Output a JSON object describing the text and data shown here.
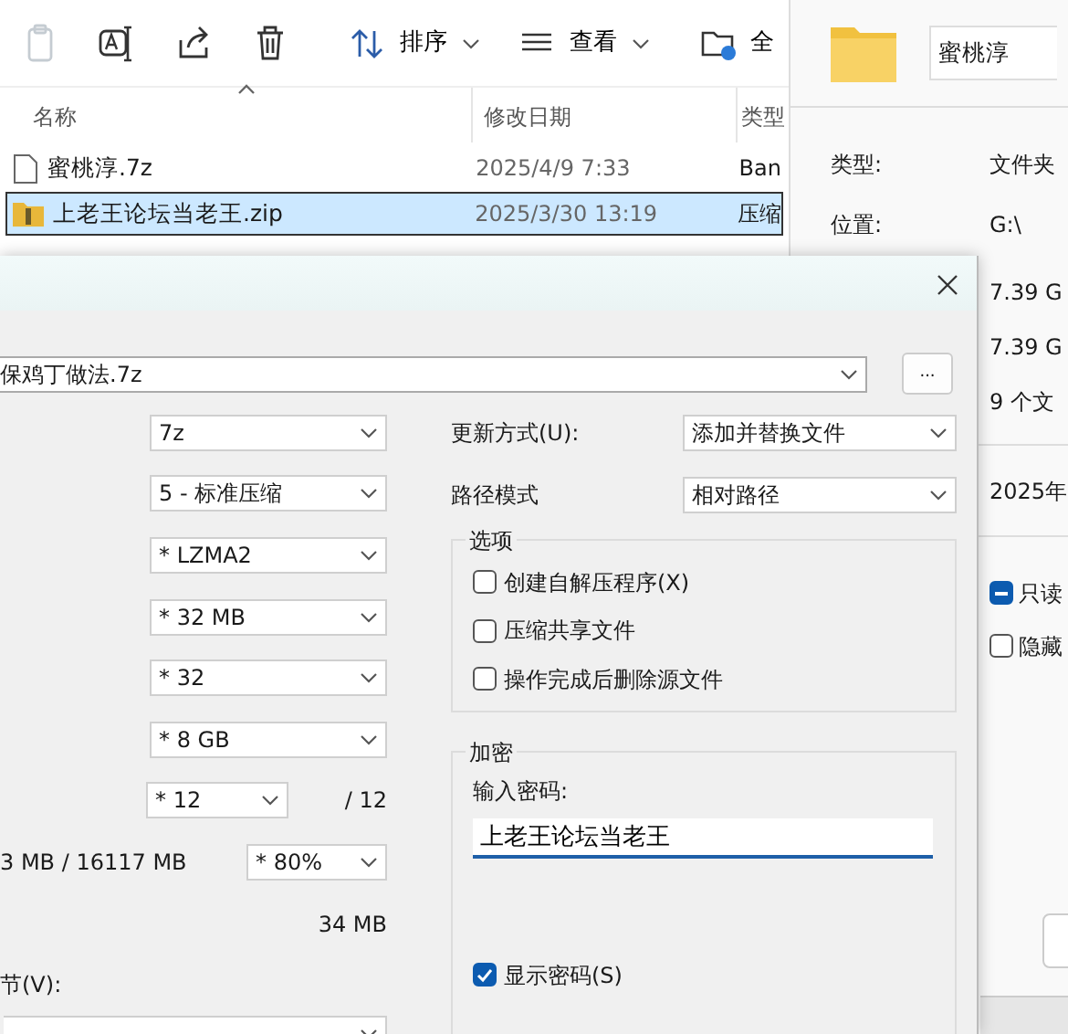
{
  "explorer": {
    "toolbar": [
      {
        "kind": "paste",
        "disabled": true
      },
      {
        "kind": "rename",
        "disabled": false
      },
      {
        "kind": "share",
        "disabled": false
      },
      {
        "kind": "delete",
        "disabled": false
      }
    ],
    "menus": [
      {
        "kind": "sort",
        "label": "排序"
      },
      {
        "kind": "view",
        "label": "查看"
      },
      {
        "kind": "all",
        "label": "全"
      }
    ],
    "columns": [
      "名称",
      "修改日期",
      "类型"
    ],
    "rows": [
      {
        "kind": "file",
        "name": "蜜桃淳.7z",
        "date": "2025/4/9 7:33",
        "type": "Ban",
        "selected": false
      },
      {
        "kind": "zip",
        "name": "上老王论坛当老王.zip",
        "date": "2025/3/30 13:19",
        "type": "压缩",
        "selected": true
      }
    ]
  },
  "properties": {
    "name": "蜜桃淳",
    "fields": [
      {
        "label": "类型:",
        "value": "文件夹"
      },
      {
        "label": "位置:",
        "value": "G:\\"
      }
    ],
    "sizes": [
      "7.39 G",
      "7.39 G",
      "9 个文"
    ],
    "date": "2025年",
    "attributes": [
      {
        "label": "只读",
        "indeterminate": true
      },
      {
        "label": "隐藏",
        "checked": false,
        "indeterminate": false
      }
    ]
  },
  "dialog": {
    "archive": "保鸡丁做法.7z",
    "browse_button": "...",
    "settings": [
      "7z",
      "5 - 标准压缩",
      "* LZMA2",
      "* 32 MB",
      "* 32",
      "* 8 GB"
    ],
    "threads": "* 12",
    "threads_max": "/ 12",
    "memory": "3 MB / 16117 MB",
    "memory_percent": "* 80%",
    "decompress_memory": "34 MB",
    "volume_label": "节(V):",
    "update": {
      "label": "更新方式(U):",
      "value": "添加并替换文件"
    },
    "path_mode": {
      "label": "路径模式",
      "value": "相对路径"
    },
    "options": {
      "title": "选项",
      "items": [
        {
          "label": "创建自解压程序(X)",
          "checked": false
        },
        {
          "label": "压缩共享文件",
          "checked": false
        },
        {
          "label": "操作完成后删除源文件",
          "checked": false
        }
      ]
    },
    "encryption": {
      "title": "加密",
      "password_label": "输入密码:",
      "password": "上老王论坛当老王",
      "show_password": {
        "label": "显示密码(S)",
        "checked": true
      }
    }
  }
}
